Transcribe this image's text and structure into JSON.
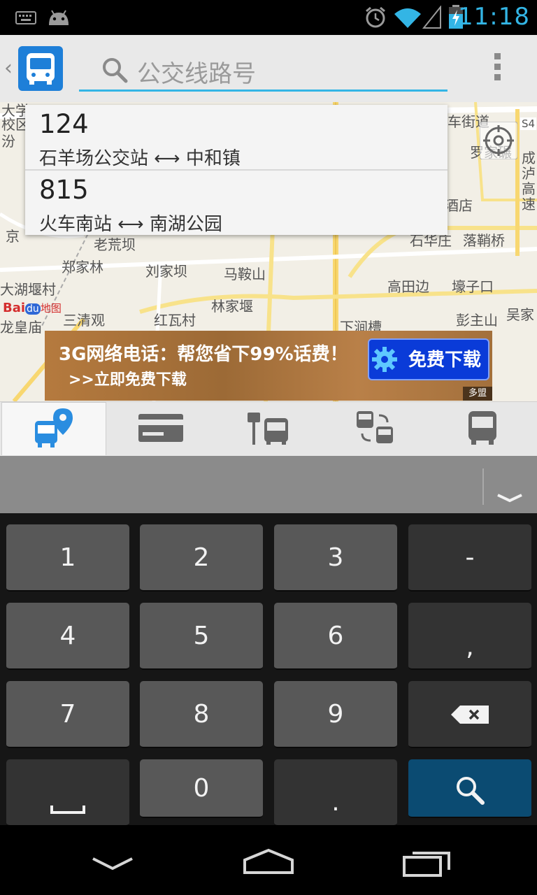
{
  "status_bar": {
    "time": "11:18",
    "icons": [
      "keyboard-icon",
      "android-icon",
      "alarm-icon",
      "wifi-icon",
      "signal-icon",
      "battery-charging-icon"
    ]
  },
  "action_bar": {
    "back_glyph": "‹",
    "search_placeholder": "公交线路号",
    "app_icon": "bus-app-icon",
    "overflow_icon": "overflow-menu-icon"
  },
  "suggestions": [
    {
      "number": "124",
      "from": "石羊场公交站",
      "to": "中和镇",
      "arrow": "⟷"
    },
    {
      "number": "815",
      "from": "火车南站",
      "to": "南湖公园",
      "arrow": "⟷"
    }
  ],
  "map": {
    "labels": [
      "大学",
      "校区",
      "汾",
      "车街道",
      "S4",
      "罗家碾",
      "成",
      "泸",
      "高",
      "速",
      "酒店",
      "京",
      "老荒坝",
      "石华庄",
      "落鞘桥",
      "郑家林",
      "刘家坝",
      "马鞍山",
      "大湖堰村",
      "高田边",
      "壕子口",
      "林家堰",
      "三清观",
      "红瓦村",
      "彭主山",
      "吴家",
      "龙皇庙",
      "下涧槽"
    ],
    "logo_text_1": "Bai",
    "logo_text_2": "du",
    "logo_text_3": "地图"
  },
  "ad": {
    "title": "3G网络电话：帮您省下99%话费！",
    "subtitle": ">>立即免费下载",
    "button": "免费下载",
    "brand": "多盟"
  },
  "tabs": [
    {
      "id": "tab-route-search",
      "icon": "bus-location-icon",
      "selected": true
    },
    {
      "id": "tab-card",
      "icon": "bus-card-icon",
      "selected": false
    },
    {
      "id": "tab-station",
      "icon": "bus-stop-icon",
      "selected": false
    },
    {
      "id": "tab-transfer",
      "icon": "bus-transfer-icon",
      "selected": false
    },
    {
      "id": "tab-bus",
      "icon": "bus-icon",
      "selected": false
    }
  ],
  "keyboard": {
    "collapse_icon": "chevron-down-icon",
    "keys": [
      [
        "1",
        "2",
        "3",
        "-"
      ],
      [
        "4",
        "5",
        "6",
        ","
      ],
      [
        "7",
        "8",
        "9",
        "⌫"
      ],
      [
        "␣",
        "0",
        ".",
        "search"
      ]
    ]
  },
  "nav_bar": [
    "back-icon",
    "home-icon",
    "recent-apps-icon"
  ],
  "colors": {
    "accent": "#33b5e5",
    "ad_button": "#0a3bd8",
    "search_key": "#0b4b72"
  }
}
